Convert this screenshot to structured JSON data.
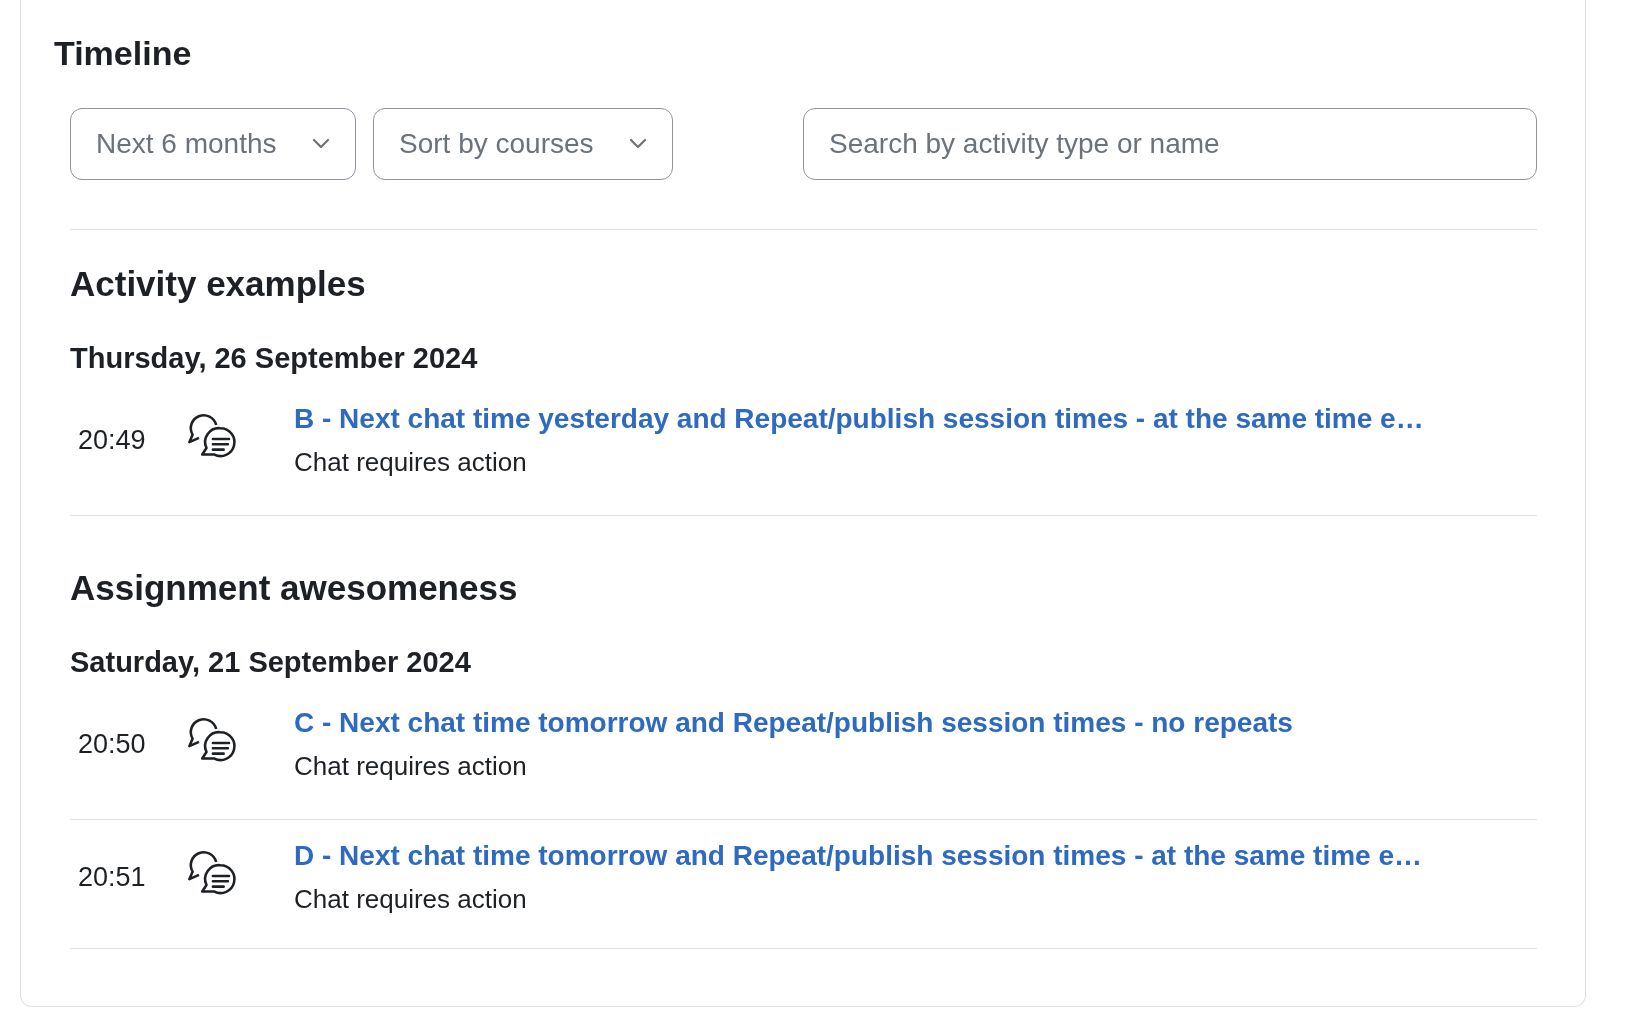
{
  "title": "Timeline",
  "filters": [
    {
      "kind": "dropdown",
      "label": "Next 6 months"
    },
    {
      "kind": "dropdown",
      "label": "Sort by courses"
    }
  ],
  "search": {
    "placeholder": "Search by activity type or name"
  },
  "courses": [
    {
      "name": "Activity examples",
      "days": [
        {
          "date": "Thursday, 26 September 2024",
          "events": [
            {
              "time": "20:49",
              "title": "B - Next chat time yesterday and Repeat/publish session times - at the same time e…",
              "action": "Chat requires action"
            }
          ]
        }
      ]
    },
    {
      "name": "Assignment awesomeness",
      "days": [
        {
          "date": "Saturday, 21 September 2024",
          "events": [
            {
              "time": "20:50",
              "title": "C - Next chat time tomorrow and Repeat/publish session times - no repeats",
              "action": "Chat requires action"
            },
            {
              "time": "20:51",
              "title": "D - Next chat time tomorrow and Repeat/publish session times - at the same time e…",
              "action": "Chat requires action"
            }
          ]
        }
      ]
    }
  ]
}
